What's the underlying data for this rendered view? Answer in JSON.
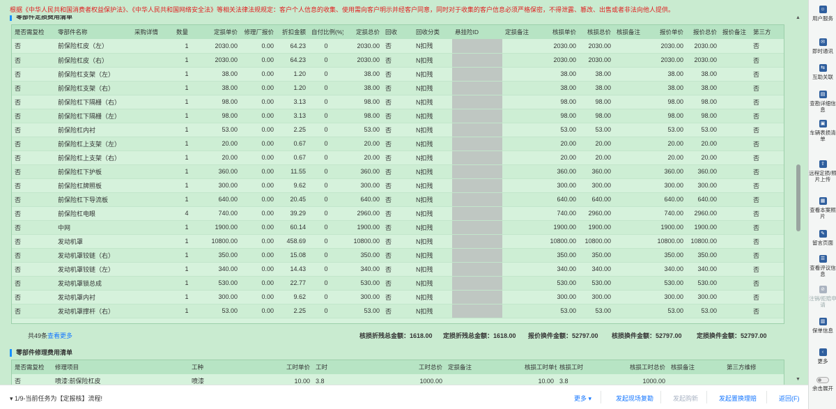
{
  "notice": "根据《中华人民共和国消费者权益保护法》、《中华人民共和国网络安全法》等相关法律法规规定：客户个人信息的收集、使用需向客户明示并经客户同意，同时对于收集的客户信息必须严格保密，不得泄露、篡改、出售或者非法向他人提供。",
  "parts": {
    "title": "零部件定损费用清单",
    "headers": [
      "是否需复检",
      "零部件名称",
      "采购详情",
      "数量",
      "定损单价",
      "修理厂报价",
      "折扣金额",
      "自付比例(%)",
      "定损总价",
      "回收",
      "回收分类",
      "悬挂险ID",
      "定损备注",
      "核损单价",
      "核损总价",
      "核损备注",
      "报价单价",
      "报价总价",
      "报价备注",
      "第三方"
    ],
    "rows": [
      [
        "否",
        "前保险杠皮（左）",
        "",
        "1",
        "2030.00",
        "0.00",
        "64.23",
        "0",
        "2030.00",
        "否",
        "N扣残",
        "",
        "",
        "2030.00",
        "2030.00",
        "",
        "2030.00",
        "2030.00",
        "",
        "否"
      ],
      [
        "否",
        "前保险杠皮（右）",
        "",
        "1",
        "2030.00",
        "0.00",
        "64.23",
        "0",
        "2030.00",
        "否",
        "N扣残",
        "",
        "",
        "2030.00",
        "2030.00",
        "",
        "2030.00",
        "2030.00",
        "",
        "否"
      ],
      [
        "否",
        "前保险杠支架（左）",
        "",
        "1",
        "38.00",
        "0.00",
        "1.20",
        "0",
        "38.00",
        "否",
        "N扣残",
        "",
        "",
        "38.00",
        "38.00",
        "",
        "38.00",
        "38.00",
        "",
        "否"
      ],
      [
        "否",
        "前保险杠支架（右）",
        "",
        "1",
        "38.00",
        "0.00",
        "1.20",
        "0",
        "38.00",
        "否",
        "N扣残",
        "",
        "",
        "38.00",
        "38.00",
        "",
        "38.00",
        "38.00",
        "",
        "否"
      ],
      [
        "否",
        "前保险杠下隔栅（右）",
        "",
        "1",
        "98.00",
        "0.00",
        "3.13",
        "0",
        "98.00",
        "否",
        "N扣残",
        "",
        "",
        "98.00",
        "98.00",
        "",
        "98.00",
        "98.00",
        "",
        "否"
      ],
      [
        "否",
        "前保险杠下隔栅（左）",
        "",
        "1",
        "98.00",
        "0.00",
        "3.13",
        "0",
        "98.00",
        "否",
        "N扣残",
        "",
        "",
        "98.00",
        "98.00",
        "",
        "98.00",
        "98.00",
        "",
        "否"
      ],
      [
        "否",
        "前保险杠内衬",
        "",
        "1",
        "53.00",
        "0.00",
        "2.25",
        "0",
        "53.00",
        "否",
        "N扣残",
        "",
        "",
        "53.00",
        "53.00",
        "",
        "53.00",
        "53.00",
        "",
        "否"
      ],
      [
        "否",
        "前保险杠上支架（左）",
        "",
        "1",
        "20.00",
        "0.00",
        "0.67",
        "0",
        "20.00",
        "否",
        "N扣残",
        "",
        "",
        "20.00",
        "20.00",
        "",
        "20.00",
        "20.00",
        "",
        "否"
      ],
      [
        "否",
        "前保险杠上支架（右）",
        "",
        "1",
        "20.00",
        "0.00",
        "0.67",
        "0",
        "20.00",
        "否",
        "N扣残",
        "",
        "",
        "20.00",
        "20.00",
        "",
        "20.00",
        "20.00",
        "",
        "否"
      ],
      [
        "否",
        "前保险杠下护板",
        "",
        "1",
        "360.00",
        "0.00",
        "11.55",
        "0",
        "360.00",
        "否",
        "N扣残",
        "",
        "",
        "360.00",
        "360.00",
        "",
        "360.00",
        "360.00",
        "",
        "否"
      ],
      [
        "否",
        "前保险杠牌照板",
        "",
        "1",
        "300.00",
        "0.00",
        "9.62",
        "0",
        "300.00",
        "否",
        "N扣残",
        "",
        "",
        "300.00",
        "300.00",
        "",
        "300.00",
        "300.00",
        "",
        "否"
      ],
      [
        "否",
        "前保险杠下导流板",
        "",
        "1",
        "640.00",
        "0.00",
        "20.45",
        "0",
        "640.00",
        "否",
        "N扣残",
        "",
        "",
        "640.00",
        "640.00",
        "",
        "640.00",
        "640.00",
        "",
        "否"
      ],
      [
        "否",
        "前保险杠电眼",
        "",
        "4",
        "740.00",
        "0.00",
        "39.29",
        "0",
        "2960.00",
        "否",
        "N扣残",
        "",
        "",
        "740.00",
        "2960.00",
        "",
        "740.00",
        "2960.00",
        "",
        "否"
      ],
      [
        "否",
        "中网",
        "",
        "1",
        "1900.00",
        "0.00",
        "60.14",
        "0",
        "1900.00",
        "否",
        "N扣残",
        "",
        "",
        "1900.00",
        "1900.00",
        "",
        "1900.00",
        "1900.00",
        "",
        "否"
      ],
      [
        "否",
        "发动机罩",
        "",
        "1",
        "10800.00",
        "0.00",
        "458.69",
        "0",
        "10800.00",
        "否",
        "N扣残",
        "",
        "",
        "10800.00",
        "10800.00",
        "",
        "10800.00",
        "10800.00",
        "",
        "否"
      ],
      [
        "否",
        "发动机罩铰链（右）",
        "",
        "1",
        "350.00",
        "0.00",
        "15.08",
        "0",
        "350.00",
        "否",
        "N扣残",
        "",
        "",
        "350.00",
        "350.00",
        "",
        "350.00",
        "350.00",
        "",
        "否"
      ],
      [
        "否",
        "发动机罩铰链（左）",
        "",
        "1",
        "340.00",
        "0.00",
        "14.43",
        "0",
        "340.00",
        "否",
        "N扣残",
        "",
        "",
        "340.00",
        "340.00",
        "",
        "340.00",
        "340.00",
        "",
        "否"
      ],
      [
        "否",
        "发动机罩锁总成",
        "",
        "1",
        "530.00",
        "0.00",
        "22.77",
        "0",
        "530.00",
        "否",
        "N扣残",
        "",
        "",
        "530.00",
        "530.00",
        "",
        "530.00",
        "530.00",
        "",
        "否"
      ],
      [
        "否",
        "发动机罩内衬",
        "",
        "1",
        "300.00",
        "0.00",
        "9.62",
        "0",
        "300.00",
        "否",
        "N扣残",
        "",
        "",
        "300.00",
        "300.00",
        "",
        "300.00",
        "300.00",
        "",
        "否"
      ],
      [
        "否",
        "发动机罩撑杆（右）",
        "",
        "1",
        "53.00",
        "0.00",
        "2.25",
        "0",
        "53.00",
        "否",
        "N扣残",
        "",
        "",
        "53.00",
        "53.00",
        "",
        "53.00",
        "53.00",
        "",
        "否"
      ]
    ],
    "count_label": "共49条",
    "more_label": "查看更多",
    "totals": [
      "核损折残总金额：1618.00",
      "定损折残总金额：1618.00",
      "报价换件金额：52797.00",
      "核损换件金额：52797.00",
      "定损换件金额：52797.00"
    ]
  },
  "repair": {
    "title": "零部件修理费用清单",
    "headers": [
      "是否需复检",
      "修理项目",
      "工种",
      "工时单价",
      "工时",
      "工时总价",
      "定损备注",
      "核损工时单价",
      "核损工时",
      "核损工时总价",
      "核损备注",
      "第三方维修"
    ],
    "rows": [
      [
        "否",
        "喷漆:前保险杠皮",
        "喷漆",
        "10.00",
        "3.8",
        "1000.00",
        "",
        "10.00",
        "3.8",
        "1000.00",
        "",
        ""
      ]
    ]
  },
  "sidebar": [
    {
      "icon": "user-service-icon",
      "label": "用户服务",
      "disabled": false
    },
    {
      "icon": "instant-message-icon",
      "label": "即时通讯",
      "disabled": false
    },
    {
      "icon": "link-icon",
      "label": "互助关联",
      "disabled": false
    },
    {
      "icon": "survey-detail-icon",
      "label": "查勘详细信息",
      "disabled": false
    },
    {
      "icon": "vehicle-loss-icon",
      "label": "车辆表损清单",
      "disabled": false
    },
    {
      "icon": "upload-icon",
      "label": "远程定损/照片上传",
      "disabled": false
    },
    {
      "icon": "photo-icon",
      "label": "查看本案照片",
      "disabled": false
    },
    {
      "icon": "comment-icon",
      "label": "留言页面",
      "disabled": false
    },
    {
      "icon": "review-icon",
      "label": "查看评议信息",
      "disabled": false
    },
    {
      "icon": "cancel-apply-icon",
      "label": "注销/拒赔申请",
      "disabled": true
    },
    {
      "icon": "warranty-icon",
      "label": "保单信息",
      "disabled": false
    },
    {
      "icon": "more-icon",
      "label": "更多",
      "disabled": false
    }
  ],
  "sidebar_toggle_label": "余击展开",
  "footer": {
    "task": "1/9-当前任务为【定报核】流程!",
    "more": "更多",
    "buttons": [
      {
        "label": "发起现场复勘",
        "disabled": false
      },
      {
        "label": "发起购新",
        "disabled": true
      },
      {
        "label": "发起置换理赔",
        "disabled": false
      },
      {
        "label": "返回(F)",
        "disabled": false
      }
    ]
  }
}
